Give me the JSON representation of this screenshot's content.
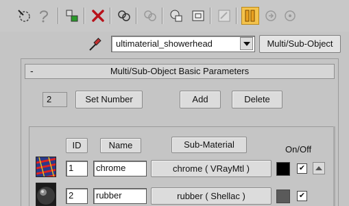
{
  "toolbar": {
    "icons": [
      "get-material-icon",
      "put-to-scene-icon",
      "assign-material-icon",
      "delete-icon",
      "make-unique-icon",
      "put-to-library-icon",
      "material-id-channel-icon",
      "show-map-icon",
      "show-end-result-icon",
      "go-to-parent-icon",
      "go-forward-sibling-icon"
    ]
  },
  "material": {
    "name": "ultimaterial_showerhead",
    "type_label": "Multi/Sub-Object"
  },
  "rollout": {
    "toggle": "-",
    "title": "Multi/Sub-Object Basic Parameters"
  },
  "controls": {
    "count": "2",
    "set_number_label": "Set Number",
    "add_label": "Add",
    "delete_label": "Delete"
  },
  "columns": {
    "id": "ID",
    "name": "Name",
    "sub_material": "Sub-Material",
    "on_off": "On/Off"
  },
  "rows": [
    {
      "id": "1",
      "name": "chrome",
      "sub_material": "chrome  ( VRayMtl )",
      "color": "#000000",
      "checked": "✔"
    },
    {
      "id": "2",
      "name": "rubber",
      "sub_material": "rubber  ( Shellac )",
      "color": "#5a5a5a",
      "checked": "✔"
    }
  ],
  "colors": {
    "active_button": "#f4c34d",
    "panel_bg": "#c5c5c5"
  }
}
